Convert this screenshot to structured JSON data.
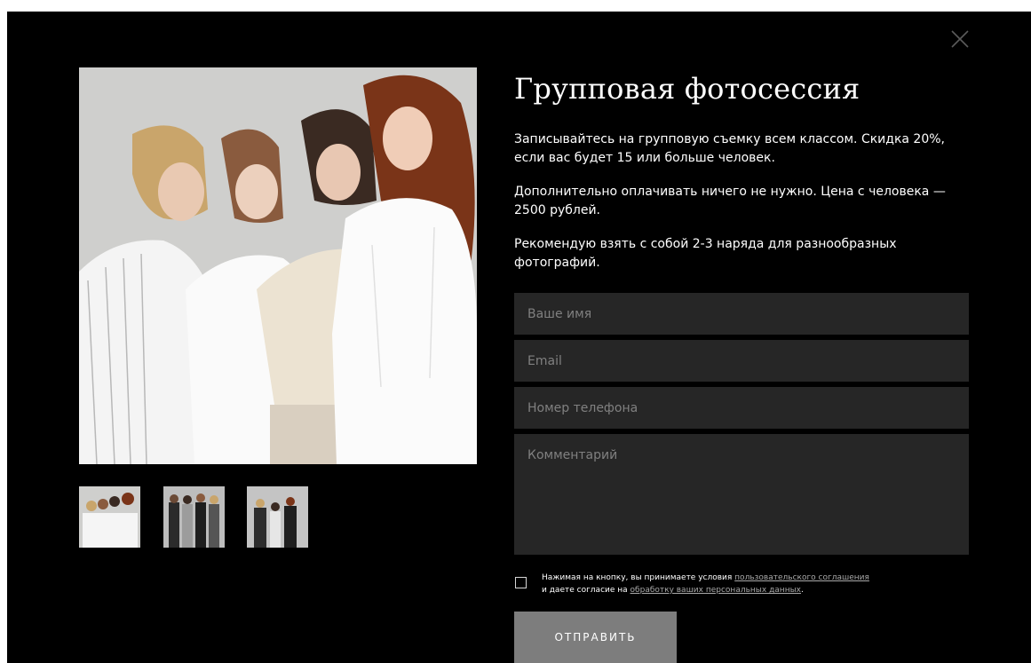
{
  "modal": {
    "close_icon": "close-icon",
    "title": "Групповая фотосессия",
    "paragraphs": [
      "Записывайтесь на групповую съемку всем классом. Скидка 20%, если вас будет 15 или больше человек.",
      "Дополнительно оплачивать ничего не нужно. Цена с человека — 2500 рублей.",
      "Рекомендую взять с собой 2-3 наряда для разнообразных фотографий."
    ]
  },
  "gallery": {
    "main_image": "group-photo-four-girls-white-shirts",
    "thumbnails": [
      "thumb-group-photo-1",
      "thumb-group-photo-2",
      "thumb-group-photo-3"
    ]
  },
  "form": {
    "name_placeholder": "Ваше имя",
    "email_placeholder": "Email",
    "phone_placeholder": "Номер телефона",
    "comment_placeholder": "Комментарий",
    "consent": {
      "text_before": "Нажимая на кнопку, вы принимаете условия ",
      "link1": "пользовательского соглашения",
      "text_middle": "и даете согласие на ",
      "link2": "обработку ваших персональных данных",
      "text_end": "."
    },
    "submit_label": "ОТПРАВИТЬ"
  },
  "colors": {
    "background": "#000000",
    "field_bg": "#262626",
    "button_bg": "#7d7d7d",
    "text": "#ffffff"
  }
}
